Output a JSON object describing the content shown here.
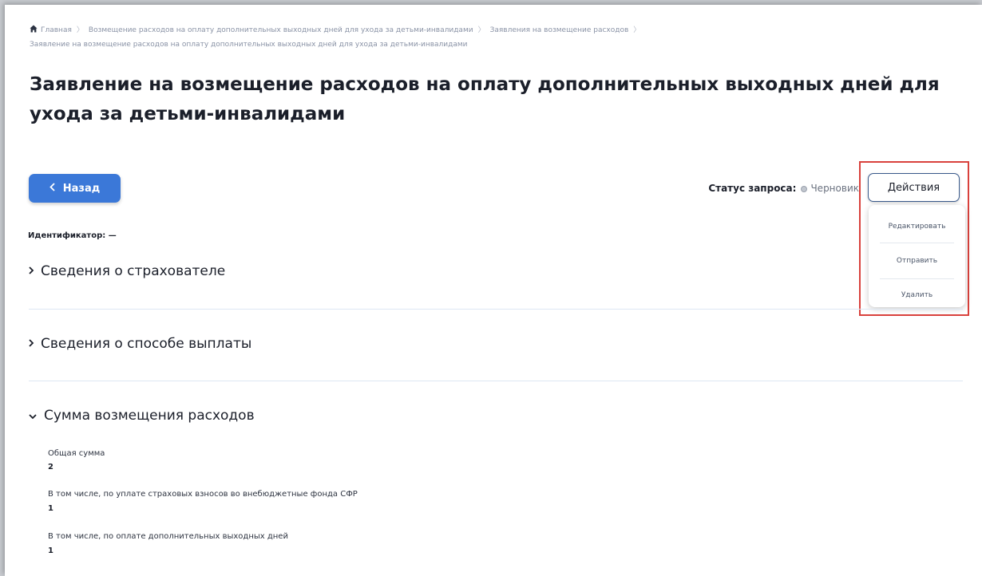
{
  "breadcrumb": {
    "items": [
      "Главная",
      "Возмещение расходов на оплату дополнительных выходных дней для ухода за детьми-инвалидами",
      "Заявления на возмещение расходов"
    ],
    "current": "Заявление на возмещение расходов на оплату дополнительных выходных дней для ухода за детьми-инвалидами"
  },
  "page": {
    "title": "Заявление на возмещение расходов на оплату дополнительных выходных дней для ухода за детьми-инвалидами"
  },
  "toolbar": {
    "back_label": "Назад",
    "status_label": "Статус запроса:",
    "status_value": "Черновик",
    "actions_label": "Действия"
  },
  "actions_menu": {
    "items": [
      "Редактировать",
      "Отправить",
      "Удалить"
    ]
  },
  "identifier": "Идентификатор: —",
  "sections": [
    {
      "title": "Сведения о страхователе",
      "expanded": false
    },
    {
      "title": "Сведения о способе выплаты",
      "expanded": false
    },
    {
      "title": "Сумма возмещения расходов",
      "expanded": true
    }
  ],
  "fields": [
    {
      "label": "Общая сумма",
      "value": "2"
    },
    {
      "label": "В том числе, по уплате страховых взносов во внебюджетные фонда СФР",
      "value": "1"
    },
    {
      "label": "В том числе, по оплате дополнительных выходных дней",
      "value": "1"
    }
  ],
  "colors": {
    "primary": "#3b78d8",
    "highlight_border": "#d9413c",
    "divider": "#dde7f3"
  }
}
